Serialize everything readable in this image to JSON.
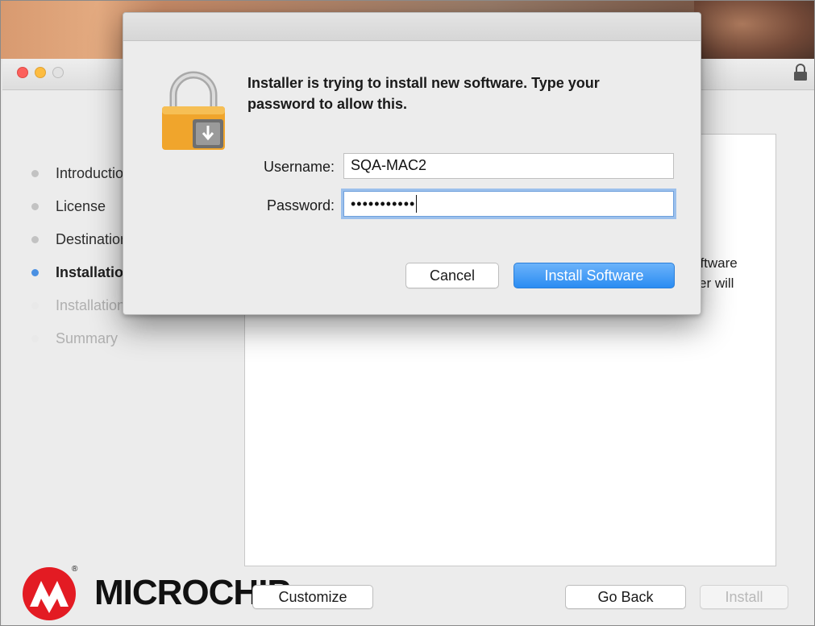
{
  "window": {
    "title": "",
    "steps": [
      {
        "label": "Introduction",
        "state": "done"
      },
      {
        "label": "License",
        "state": "done"
      },
      {
        "label": "Destination Select",
        "state": "done"
      },
      {
        "label": "Installation Type",
        "state": "current"
      },
      {
        "label": "Installation",
        "state": "pending"
      },
      {
        "label": "Summary",
        "state": "pending"
      }
    ],
    "partial_text": [
      "oftware",
      "er will"
    ],
    "buttons": {
      "customize": "Customize",
      "go_back": "Go Back",
      "install": "Install"
    },
    "brand": {
      "name": "MICROCHIP",
      "color": "#e31b23"
    }
  },
  "dialog": {
    "message": "Installer is trying to install new software. Type your password to allow this.",
    "username_label": "Username:",
    "username_value": "SQA-MAC2",
    "password_label": "Password:",
    "password_value": "•••••••••••",
    "cancel_label": "Cancel",
    "confirm_label": "Install Software",
    "icon": "lock-icon"
  },
  "colors": {
    "accent": "#2a8cf2",
    "focus_ring": "#9cc0ec",
    "current_step_dot": "#4a90e2"
  }
}
